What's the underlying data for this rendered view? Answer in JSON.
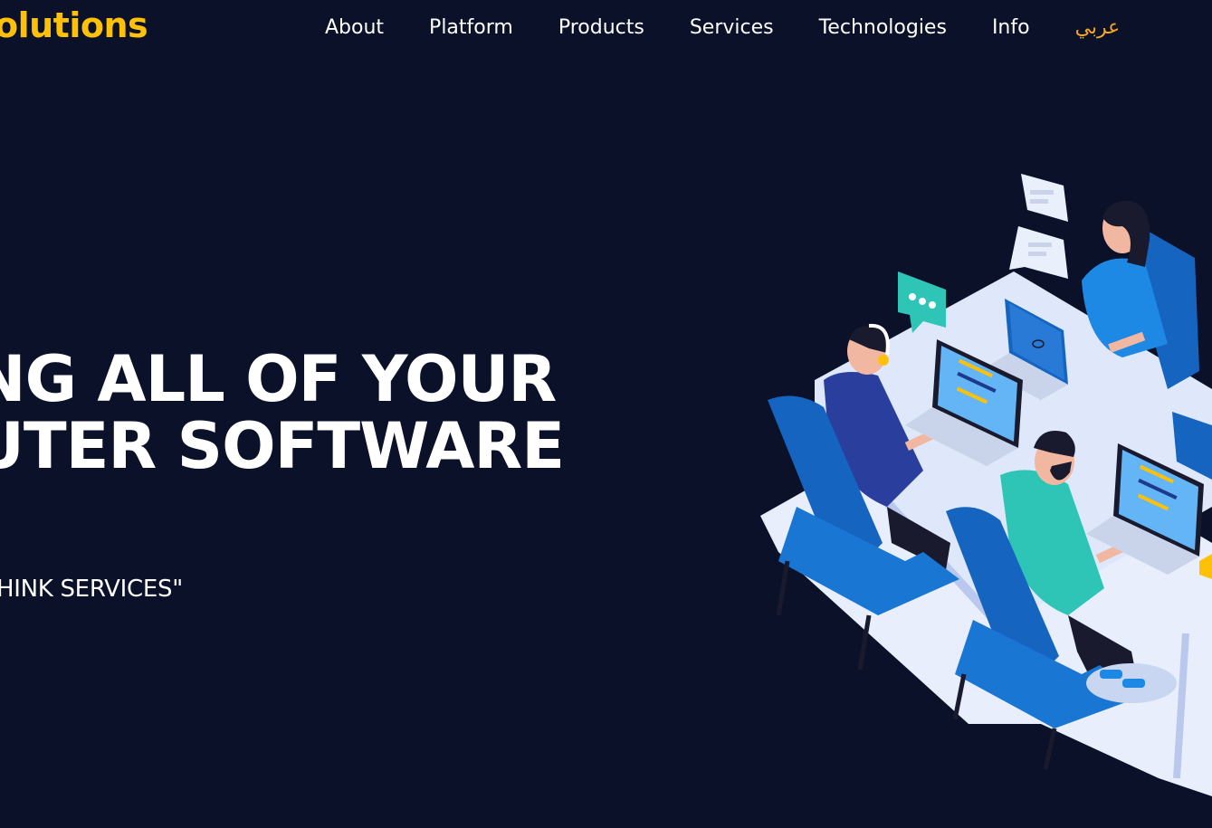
{
  "header": {
    "logo_text": "olutions",
    "nav": [
      {
        "label": "About"
      },
      {
        "label": "Platform"
      },
      {
        "label": "Products"
      },
      {
        "label": "Services"
      },
      {
        "label": "Technologies"
      },
      {
        "label": "Info"
      },
      {
        "label": "عربي"
      }
    ]
  },
  "hero": {
    "headline_line1": "NG ALL OF YOUR",
    "headline_line2": "UTER SOFTWARE",
    "tagline": "HINK SERVICES\""
  },
  "colors": {
    "background": "#0a1128",
    "accent": "#ffc107",
    "lang_link": "#f5a623",
    "illustration_blue": "#1e88e5",
    "illustration_teal": "#2ec4b6"
  }
}
